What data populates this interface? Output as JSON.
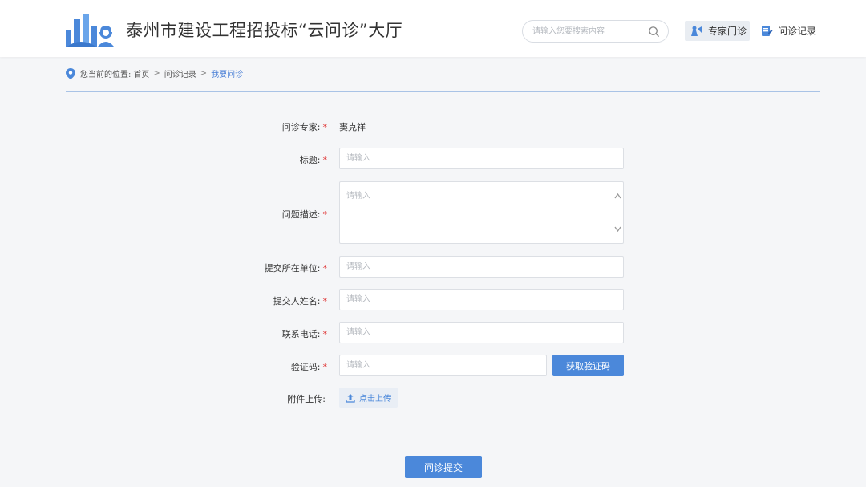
{
  "header": {
    "title": "泰州市建设工程招投标“云问诊”大厅",
    "search_placeholder": "请输入您要搜索内容",
    "nav": {
      "expert_label": "专家门诊",
      "record_label": "问诊记录"
    }
  },
  "breadcrumb": {
    "prefix": "您当前的位置:",
    "items": [
      "首页",
      "问诊记录",
      "我要问诊"
    ],
    "separator": ">"
  },
  "form": {
    "expert": {
      "label": "问诊专家:",
      "value": "窦克祥"
    },
    "title": {
      "label": "标题:",
      "placeholder": "请输入"
    },
    "description": {
      "label": "问题描述:",
      "placeholder": "请输入"
    },
    "unit": {
      "label": "提交所在单位:",
      "placeholder": "请输入"
    },
    "name": {
      "label": "提交人姓名:",
      "placeholder": "请输入"
    },
    "phone": {
      "label": "联系电话:",
      "placeholder": "请输入"
    },
    "code": {
      "label": "验证码:",
      "placeholder": "请输入",
      "button_label": "获取验证码"
    },
    "attachment": {
      "label": "附件上传:",
      "button_label": "点击上传"
    },
    "required_mark": "*",
    "submit_label": "问诊提交"
  },
  "colors": {
    "accent": "#4b88da",
    "required": "#e03c3c",
    "divider": "#a9c3e6"
  }
}
